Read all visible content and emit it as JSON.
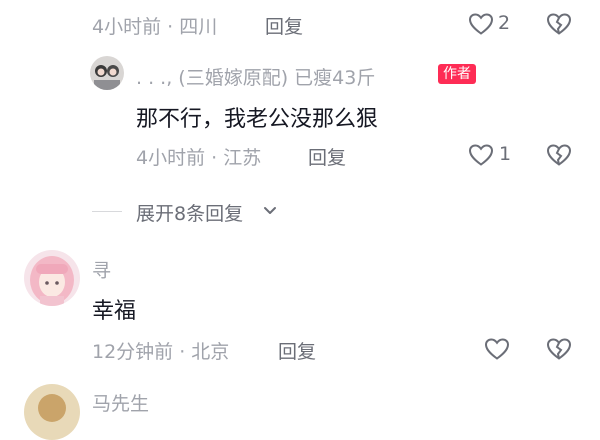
{
  "top_comment": {
    "meta": "4小时前 · 四川",
    "reply_label": "回复",
    "like_count": "2"
  },
  "author_reply": {
    "username": ". . ., (三婚嫁原配) 已瘦43斤",
    "author_tag": "作者",
    "content": "那不行，我老公没那么狠",
    "meta": "4小时前 · 江苏",
    "reply_label": "回复",
    "like_count": "1"
  },
  "expand": {
    "label": "展开8条回复"
  },
  "comment_xun": {
    "username": "寻",
    "content": "幸福",
    "meta": "12分钟前 · 北京",
    "reply_label": "回复"
  },
  "next_comment": {
    "username": "马先生"
  },
  "colors": {
    "accent": "#fe2c55",
    "meta": "#a0a3ab"
  },
  "icons": [
    "heart-icon",
    "dislike-heart-icon",
    "chevron-down-icon"
  ]
}
